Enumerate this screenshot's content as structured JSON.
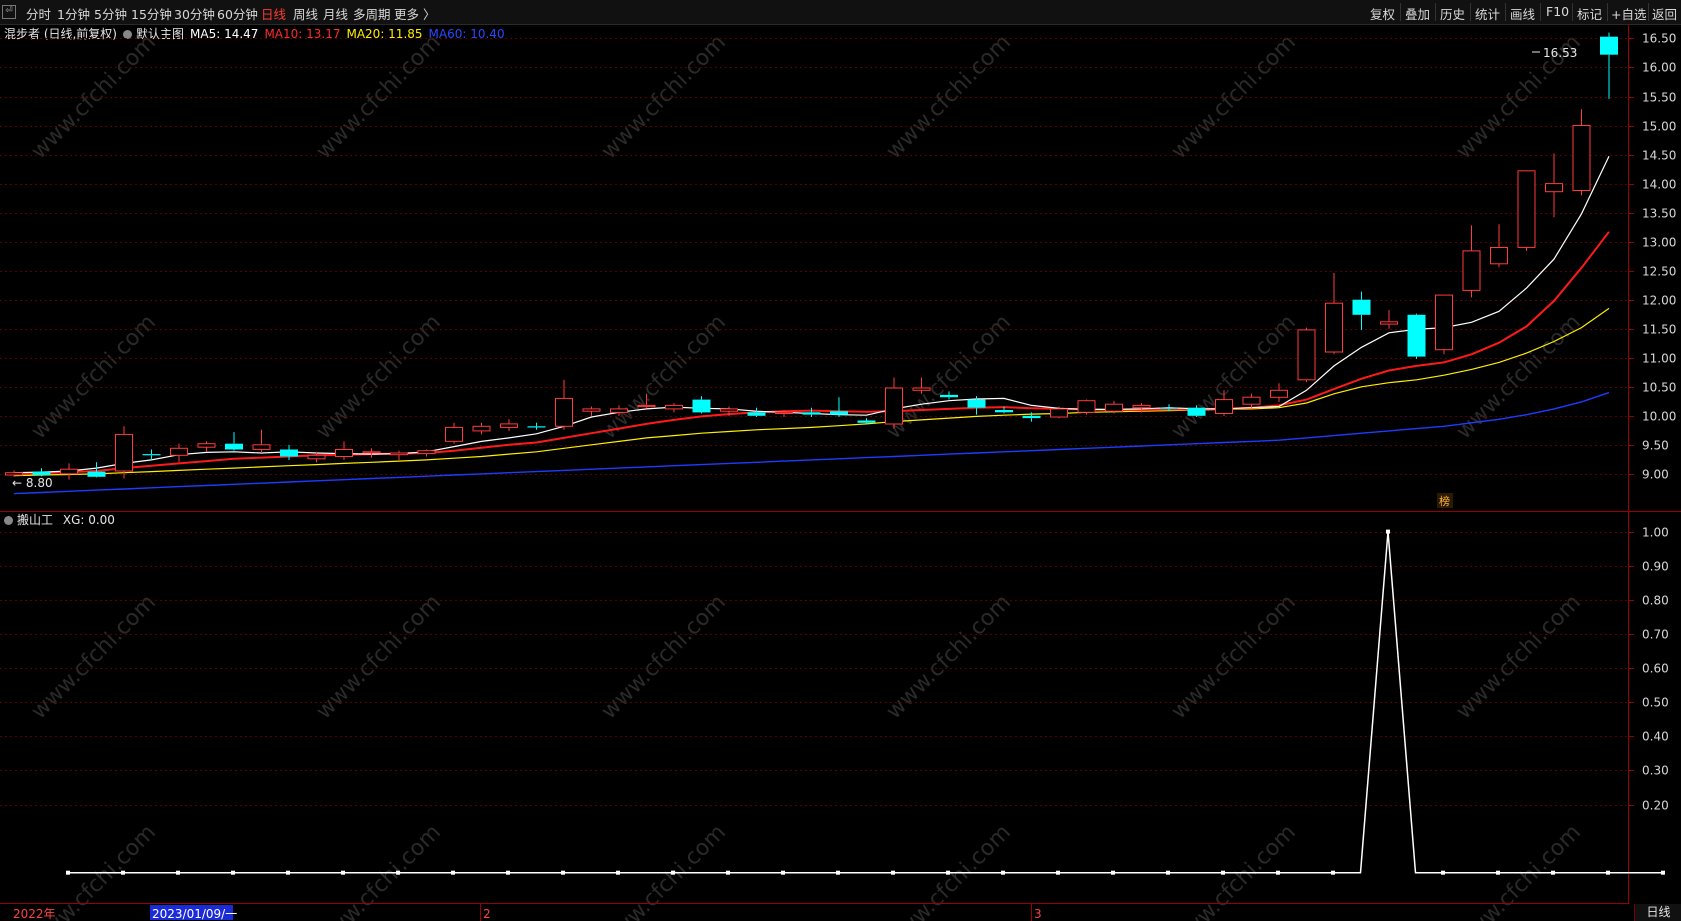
{
  "toolbar": {
    "corner": "⏎",
    "tabs": [
      {
        "label": "分时",
        "active": false
      },
      {
        "label": "1分钟",
        "active": false
      },
      {
        "label": "5分钟",
        "active": false
      },
      {
        "label": "15分钟",
        "active": false
      },
      {
        "label": "30分钟",
        "active": false
      },
      {
        "label": "60分钟",
        "active": false
      },
      {
        "label": "日线",
        "active": true
      },
      {
        "label": "周线",
        "active": false
      },
      {
        "label": "月线",
        "active": false
      },
      {
        "label": "多周期",
        "active": false
      },
      {
        "label": "更多 〉",
        "active": false
      }
    ],
    "right": [
      "复权",
      "叠加",
      "历史",
      "统计",
      "画线",
      "F10",
      "标记",
      "+自选",
      "返回"
    ]
  },
  "legend": {
    "stock": "混步者 (日线,前复权)",
    "main_chart": "默认主图",
    "ma5": "MA5: 14.47",
    "ma10": "MA10: 13.17",
    "ma20": "MA20: 11.85",
    "ma60": "MA60: 10.40"
  },
  "indicator_legend": {
    "name": "搬山工",
    "value": "XG: 0.00"
  },
  "watermark": "www.cfchi.com",
  "price_labels": {
    "high": "16.53",
    "low": "8.80",
    "badge": "榜"
  },
  "date_axis": {
    "year": "2022年",
    "selected": "2023/01/09/一",
    "month2": "2",
    "month3": "3"
  },
  "period_tab": "日线",
  "colors": {
    "up": "#ff3b3b",
    "down": "#00ffff",
    "ma5": "#ffffff",
    "ma10": "#ff1a1a",
    "ma20": "#ffee00",
    "ma60": "#1e3cff",
    "grid": "#5a0000",
    "xg": "#ffffff"
  },
  "chart_data": [
    {
      "type": "candlestick",
      "title": "",
      "yaxis_ticks": [
        9.0,
        9.5,
        10.0,
        10.5,
        11.0,
        11.5,
        12.0,
        12.5,
        13.0,
        13.5,
        14.0,
        14.5,
        15.0,
        15.5,
        16.0,
        16.5
      ],
      "ylim": [
        8.55,
        16.68
      ],
      "candles": [
        {
          "o": 8.98,
          "h": 9.06,
          "l": 8.95,
          "c": 9.02
        },
        {
          "o": 9.04,
          "h": 9.1,
          "l": 8.96,
          "c": 8.98
        },
        {
          "o": 9.0,
          "h": 9.18,
          "l": 8.9,
          "c": 9.08
        },
        {
          "o": 9.04,
          "h": 9.2,
          "l": 8.94,
          "c": 8.95
        },
        {
          "o": 9.05,
          "h": 9.82,
          "l": 8.92,
          "c": 9.68
        },
        {
          "o": 9.34,
          "h": 9.42,
          "l": 9.24,
          "c": 9.32
        },
        {
          "o": 9.32,
          "h": 9.52,
          "l": 9.2,
          "c": 9.44
        },
        {
          "o": 9.46,
          "h": 9.56,
          "l": 9.38,
          "c": 9.52
        },
        {
          "o": 9.52,
          "h": 9.72,
          "l": 9.4,
          "c": 9.42
        },
        {
          "o": 9.42,
          "h": 9.76,
          "l": 9.36,
          "c": 9.5
        },
        {
          "o": 9.42,
          "h": 9.5,
          "l": 9.24,
          "c": 9.3
        },
        {
          "o": 9.26,
          "h": 9.38,
          "l": 9.2,
          "c": 9.32
        },
        {
          "o": 9.3,
          "h": 9.56,
          "l": 9.24,
          "c": 9.42
        },
        {
          "o": 9.36,
          "h": 9.44,
          "l": 9.28,
          "c": 9.38
        },
        {
          "o": 9.33,
          "h": 9.4,
          "l": 9.24,
          "c": 9.36
        },
        {
          "o": 9.35,
          "h": 9.42,
          "l": 9.3,
          "c": 9.4
        },
        {
          "o": 9.56,
          "h": 9.88,
          "l": 9.52,
          "c": 9.8
        },
        {
          "o": 9.74,
          "h": 9.88,
          "l": 9.68,
          "c": 9.82
        },
        {
          "o": 9.8,
          "h": 9.94,
          "l": 9.74,
          "c": 9.86
        },
        {
          "o": 9.82,
          "h": 9.88,
          "l": 9.76,
          "c": 9.8
        },
        {
          "o": 9.82,
          "h": 10.62,
          "l": 9.76,
          "c": 10.3
        },
        {
          "o": 10.08,
          "h": 10.16,
          "l": 10.0,
          "c": 10.12
        },
        {
          "o": 10.06,
          "h": 10.18,
          "l": 10.0,
          "c": 10.12
        },
        {
          "o": 10.16,
          "h": 10.38,
          "l": 10.14,
          "c": 10.18
        },
        {
          "o": 10.12,
          "h": 10.22,
          "l": 10.06,
          "c": 10.18
        },
        {
          "o": 10.28,
          "h": 10.34,
          "l": 10.04,
          "c": 10.06
        },
        {
          "o": 10.08,
          "h": 10.16,
          "l": 10.0,
          "c": 10.12
        },
        {
          "o": 10.06,
          "h": 10.14,
          "l": 9.98,
          "c": 10.0
        },
        {
          "o": 10.04,
          "h": 10.1,
          "l": 9.98,
          "c": 10.06
        },
        {
          "o": 10.06,
          "h": 10.14,
          "l": 9.98,
          "c": 10.02
        },
        {
          "o": 10.08,
          "h": 10.32,
          "l": 9.98,
          "c": 10.02
        },
        {
          "o": 9.92,
          "h": 9.96,
          "l": 9.86,
          "c": 9.88
        },
        {
          "o": 9.86,
          "h": 10.66,
          "l": 9.78,
          "c": 10.48
        },
        {
          "o": 10.44,
          "h": 10.66,
          "l": 10.38,
          "c": 10.48
        },
        {
          "o": 10.36,
          "h": 10.42,
          "l": 10.28,
          "c": 10.32
        },
        {
          "o": 10.28,
          "h": 10.34,
          "l": 10.02,
          "c": 10.14
        },
        {
          "o": 10.1,
          "h": 10.16,
          "l": 10.04,
          "c": 10.06
        },
        {
          "o": 10.0,
          "h": 10.06,
          "l": 9.9,
          "c": 9.96
        },
        {
          "o": 9.98,
          "h": 10.16,
          "l": 9.96,
          "c": 10.12
        },
        {
          "o": 10.06,
          "h": 10.28,
          "l": 10.02,
          "c": 10.26
        },
        {
          "o": 10.08,
          "h": 10.26,
          "l": 10.04,
          "c": 10.2
        },
        {
          "o": 10.14,
          "h": 10.22,
          "l": 10.06,
          "c": 10.18
        },
        {
          "o": 10.14,
          "h": 10.2,
          "l": 10.08,
          "c": 10.12
        },
        {
          "o": 10.14,
          "h": 10.18,
          "l": 9.98,
          "c": 10.0
        },
        {
          "o": 10.04,
          "h": 10.44,
          "l": 10.0,
          "c": 10.28
        },
        {
          "o": 10.2,
          "h": 10.38,
          "l": 10.14,
          "c": 10.32
        },
        {
          "o": 10.32,
          "h": 10.56,
          "l": 10.24,
          "c": 10.44
        },
        {
          "o": 10.62,
          "h": 11.52,
          "l": 10.58,
          "c": 11.48
        },
        {
          "o": 11.1,
          "h": 12.46,
          "l": 11.06,
          "c": 11.94
        },
        {
          "o": 12.0,
          "h": 12.14,
          "l": 11.48,
          "c": 11.74
        },
        {
          "o": 11.58,
          "h": 11.82,
          "l": 11.5,
          "c": 11.62
        },
        {
          "o": 11.74,
          "h": 11.76,
          "l": 10.98,
          "c": 11.02
        },
        {
          "o": 11.14,
          "h": 12.08,
          "l": 11.06,
          "c": 12.08
        },
        {
          "o": 12.16,
          "h": 13.28,
          "l": 12.04,
          "c": 12.84
        },
        {
          "o": 12.62,
          "h": 13.3,
          "l": 12.56,
          "c": 12.9
        },
        {
          "o": 12.9,
          "h": 14.22,
          "l": 12.84,
          "c": 14.22
        },
        {
          "o": 13.86,
          "h": 14.52,
          "l": 13.42,
          "c": 14.0
        },
        {
          "o": 13.88,
          "h": 15.28,
          "l": 13.8,
          "c": 15.0
        },
        {
          "o": 16.53,
          "h": 16.6,
          "l": 15.46,
          "c": 16.22
        }
      ],
      "ma5": [
        9.02,
        9.03,
        9.05,
        9.1,
        9.18,
        9.24,
        9.33,
        9.37,
        9.38,
        9.36,
        9.38,
        9.36,
        9.35,
        9.34,
        9.35,
        9.38,
        9.47,
        9.56,
        9.62,
        9.69,
        9.82,
        9.98,
        10.06,
        10.12,
        10.15,
        10.13,
        10.12,
        10.08,
        10.06,
        10.04,
        10.02,
        10.01,
        10.12,
        10.2,
        10.26,
        10.29,
        10.3,
        10.18,
        10.13,
        10.11,
        10.11,
        10.12,
        10.14,
        10.12,
        10.12,
        10.14,
        10.16,
        10.44,
        10.86,
        11.18,
        11.43,
        11.49,
        11.52,
        11.61,
        11.8,
        12.2,
        12.7,
        13.48,
        14.47
      ],
      "ma10": [
        9.0,
        9.01,
        9.03,
        9.05,
        9.1,
        9.14,
        9.18,
        9.22,
        9.26,
        9.28,
        9.3,
        9.32,
        9.33,
        9.34,
        9.35,
        9.36,
        9.4,
        9.45,
        9.5,
        9.54,
        9.62,
        9.7,
        9.78,
        9.86,
        9.93,
        9.99,
        10.03,
        10.06,
        10.08,
        10.09,
        10.08,
        10.07,
        10.08,
        10.1,
        10.12,
        10.14,
        10.15,
        10.13,
        10.12,
        10.11,
        10.1,
        10.1,
        10.11,
        10.11,
        10.12,
        10.14,
        10.18,
        10.28,
        10.46,
        10.64,
        10.78,
        10.86,
        10.92,
        11.06,
        11.26,
        11.54,
        11.98,
        12.55,
        13.17
      ],
      "ma20": [
        8.97,
        8.98,
        8.99,
        9.0,
        9.02,
        9.04,
        9.06,
        9.08,
        9.1,
        9.12,
        9.14,
        9.16,
        9.18,
        9.2,
        9.22,
        9.24,
        9.27,
        9.3,
        9.34,
        9.38,
        9.44,
        9.5,
        9.56,
        9.62,
        9.66,
        9.7,
        9.73,
        9.76,
        9.78,
        9.8,
        9.83,
        9.86,
        9.9,
        9.93,
        9.96,
        9.99,
        10.01,
        10.03,
        10.04,
        10.06,
        10.07,
        10.08,
        10.09,
        10.1,
        10.11,
        10.12,
        10.14,
        10.22,
        10.38,
        10.5,
        10.57,
        10.62,
        10.7,
        10.8,
        10.92,
        11.08,
        11.28,
        11.52,
        11.85
      ],
      "ma60": [
        8.66,
        8.68,
        8.7,
        8.72,
        8.74,
        8.76,
        8.78,
        8.8,
        8.82,
        8.84,
        8.86,
        8.88,
        8.9,
        8.92,
        8.94,
        8.96,
        8.98,
        9.0,
        9.02,
        9.04,
        9.06,
        9.08,
        9.1,
        9.12,
        9.14,
        9.16,
        9.18,
        9.2,
        9.22,
        9.24,
        9.26,
        9.28,
        9.3,
        9.32,
        9.34,
        9.36,
        9.38,
        9.4,
        9.42,
        9.44,
        9.46,
        9.48,
        9.5,
        9.52,
        9.54,
        9.56,
        9.58,
        9.62,
        9.66,
        9.7,
        9.74,
        9.78,
        9.82,
        9.88,
        9.94,
        10.02,
        10.12,
        10.24,
        10.4
      ]
    },
    {
      "type": "line",
      "title": "",
      "series": [
        {
          "name": "XG",
          "values": [
            0,
            0,
            0,
            0,
            0,
            0,
            0,
            0,
            0,
            0,
            0,
            0,
            0,
            0,
            0,
            0,
            0,
            0,
            0,
            0,
            0,
            0,
            0,
            0,
            0,
            0,
            0,
            0,
            0,
            0,
            0,
            0,
            0,
            0,
            0,
            0,
            0,
            0,
            0,
            0,
            0,
            0,
            0,
            0,
            0,
            0,
            0,
            0,
            1,
            0,
            0,
            0,
            0,
            0,
            0,
            0,
            0,
            0,
            0
          ]
        }
      ],
      "yaxis_ticks": [
        0.2,
        0.3,
        0.4,
        0.5,
        0.6,
        0.7,
        0.8,
        0.9,
        1.0
      ],
      "ylim": [
        -0.08,
        1.04
      ]
    }
  ]
}
